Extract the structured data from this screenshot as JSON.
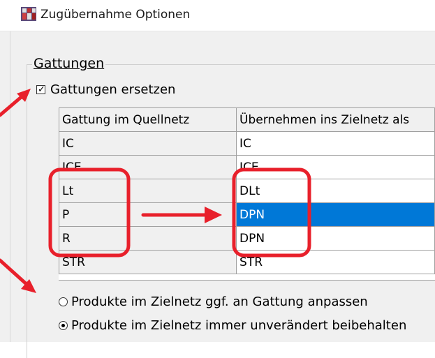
{
  "window": {
    "title": "Zugübernahme Optionen",
    "app_icon": "train-map-icon"
  },
  "group": {
    "label": "Gattungen"
  },
  "checkbox": {
    "label": "Gattungen ersetzen",
    "checked": true
  },
  "grid": {
    "headers": [
      "Gattung im Quellnetz",
      "Übernehmen ins Zielnetz als"
    ],
    "rows": [
      {
        "source": "IC",
        "target": "IC",
        "selected": false
      },
      {
        "source": "ICE",
        "target": "ICE",
        "selected": false
      },
      {
        "source": "Lt",
        "target": "DLt",
        "selected": false
      },
      {
        "source": "P",
        "target": "DPN",
        "selected": true
      },
      {
        "source": "R",
        "target": "DPN",
        "selected": false
      },
      {
        "source": "STR",
        "target": "STR",
        "selected": false
      }
    ]
  },
  "radios": [
    {
      "label": "Produkte im Zielnetz ggf. an Gattung anpassen",
      "checked": false
    },
    {
      "label": "Produkte im Zielnetz immer unverändert beibehalten",
      "checked": true
    }
  ],
  "annotations": {
    "color": "#e8202b",
    "items": [
      "arrow-to-checkbox",
      "arrow-to-radio",
      "highlight-box-source",
      "highlight-box-target",
      "arrow-between-boxes"
    ]
  },
  "colors": {
    "selection": "#0078d7",
    "header_bg": "#f0f0f0",
    "window_bg": "#f0f0f0"
  }
}
